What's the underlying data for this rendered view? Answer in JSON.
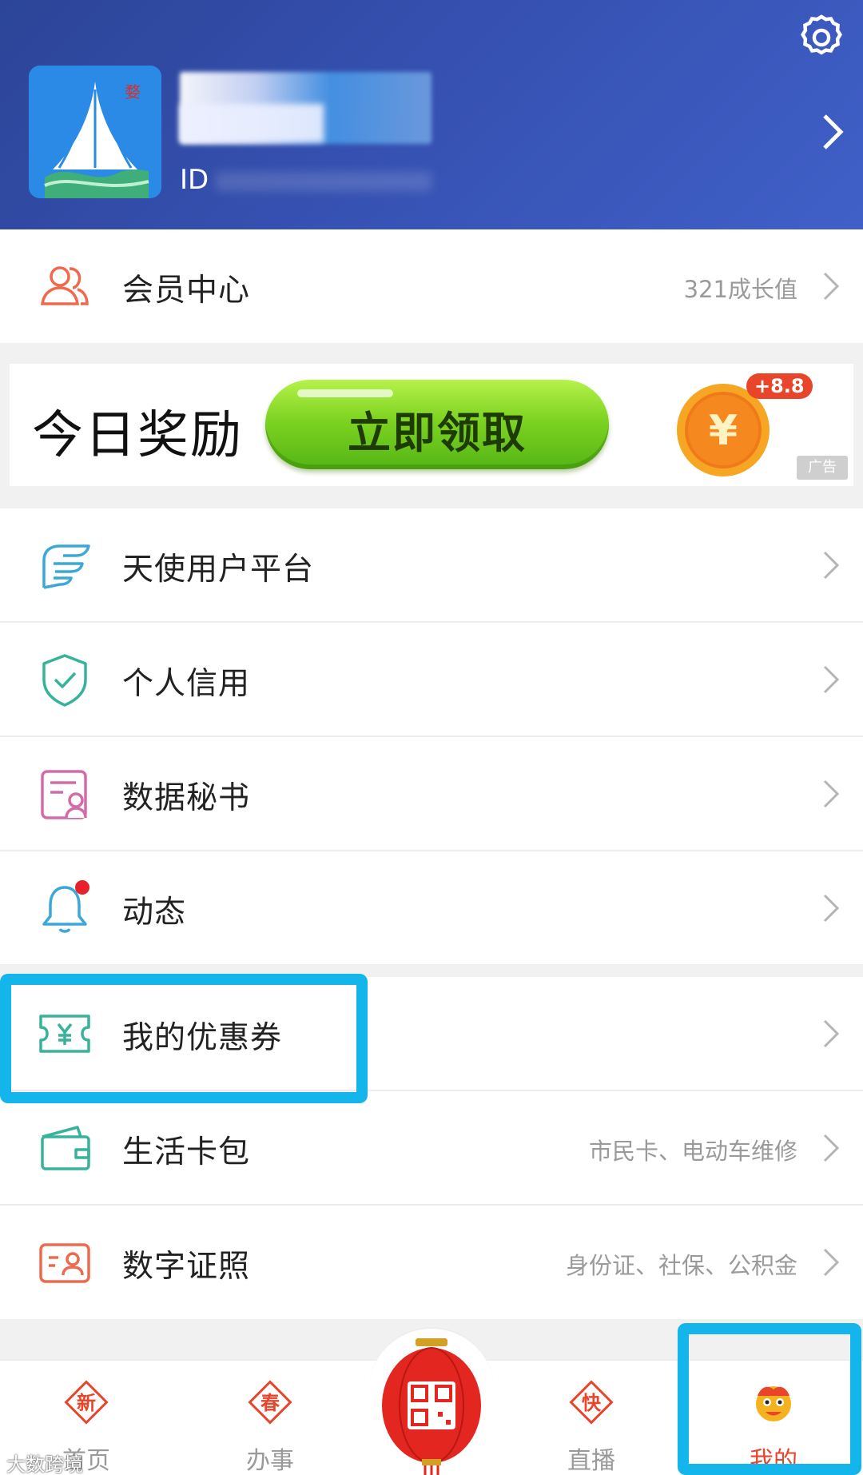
{
  "header": {
    "id_label": "ID"
  },
  "member": {
    "label": "会员中心",
    "value": "321成长值"
  },
  "banner": {
    "title": "今日奖励",
    "button": "立即领取",
    "bonus": "+8.8",
    "currency_symbol": "¥",
    "ad": "广告"
  },
  "menu_group1": [
    {
      "label": "天使用户平台",
      "icon": "wing-icon"
    },
    {
      "label": "个人信用",
      "icon": "shield-check-icon"
    },
    {
      "label": "数据秘书",
      "icon": "document-user-icon"
    },
    {
      "label": "动态",
      "icon": "bell-icon",
      "badge": true
    }
  ],
  "menu_group2": [
    {
      "label": "我的优惠券",
      "icon": "coupon-icon",
      "value": ""
    },
    {
      "label": "生活卡包",
      "icon": "wallet-icon",
      "value": "市民卡、电动车维修"
    },
    {
      "label": "数字证照",
      "icon": "id-card-icon",
      "value": "身份证、社保、公积金"
    }
  ],
  "tabbar": {
    "tabs": [
      {
        "label": "首页",
        "badge": "新"
      },
      {
        "label": "办事",
        "badge": "春"
      },
      {
        "label": "",
        "badge": ""
      },
      {
        "label": "直播",
        "badge": "快"
      },
      {
        "label": "我的",
        "badge": ""
      }
    ]
  },
  "watermark": "大数跨境",
  "colors": {
    "header": "#3550b0",
    "accent": "#e8452a",
    "highlight": "#13b5ea",
    "green": "#7ed321"
  }
}
